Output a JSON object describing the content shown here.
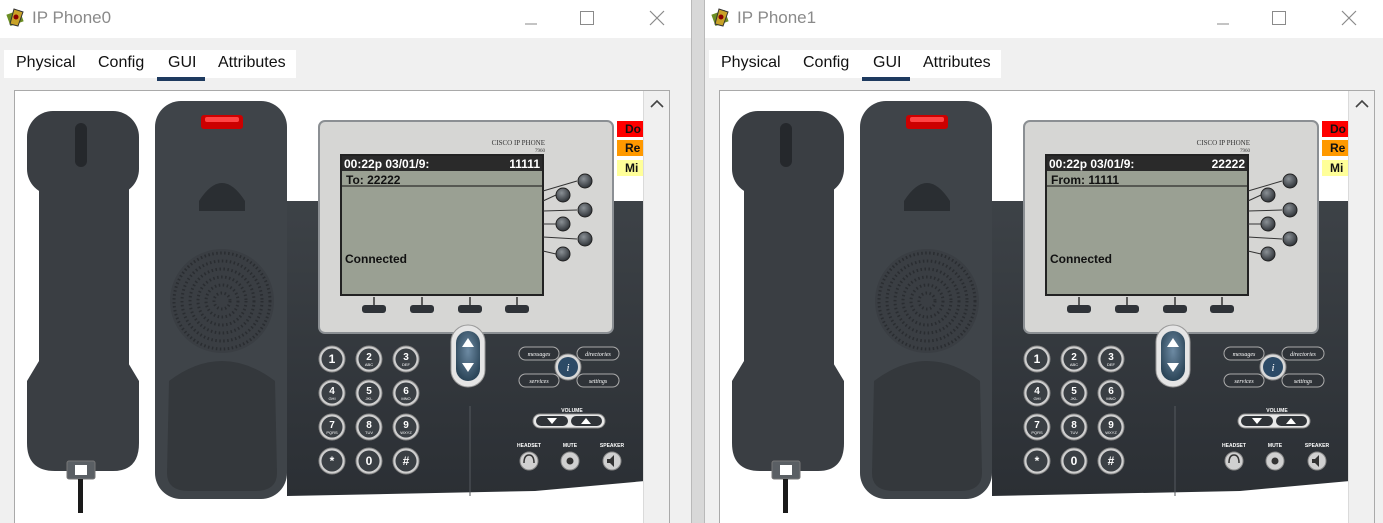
{
  "windows": [
    {
      "title": "IP Phone0",
      "tabs": [
        "Physical",
        "Config",
        "GUI",
        "Attributes"
      ],
      "active_tab": "GUI",
      "phone": {
        "brand": "CISCO IP PHONE",
        "model": "7960",
        "time": "00:22p 03/01/9:",
        "extension": "11111",
        "call_line": "To: 22222",
        "status": "Connected"
      },
      "indicators": [
        "Do",
        "Re",
        "Mi"
      ]
    },
    {
      "title": "IP Phone1",
      "tabs": [
        "Physical",
        "Config",
        "GUI",
        "Attributes"
      ],
      "active_tab": "GUI",
      "phone": {
        "brand": "CISCO IP PHONE",
        "model": "7960",
        "time": "00:22p 03/01/9:",
        "extension": "22222",
        "call_line": "From: 11111",
        "status": "Connected"
      },
      "indicators": [
        "Do",
        "Re",
        "Mi"
      ]
    }
  ],
  "keypad": [
    {
      "d": "1",
      "s": ""
    },
    {
      "d": "2",
      "s": "ABC"
    },
    {
      "d": "3",
      "s": "DEF"
    },
    {
      "d": "4",
      "s": "GHI"
    },
    {
      "d": "5",
      "s": "JKL"
    },
    {
      "d": "6",
      "s": "MNO"
    },
    {
      "d": "7",
      "s": "PQRS"
    },
    {
      "d": "8",
      "s": "TUV"
    },
    {
      "d": "9",
      "s": "WXYZ"
    },
    {
      "d": "*",
      "s": ""
    },
    {
      "d": "0",
      "s": ""
    },
    {
      "d": "#",
      "s": ""
    }
  ],
  "labels": {
    "messages": "messages",
    "directories": "directories",
    "services": "services",
    "settings": "settings",
    "volume": "VOLUME",
    "headset": "HEADSET",
    "mute": "MUTE",
    "speaker": "SPEAKER",
    "info": "i"
  },
  "colors": {
    "indicators": [
      "#ff0000",
      "#ff9900",
      "#ffff99"
    ],
    "tab_underline": "#1e3a5f",
    "screen": "#9aa093"
  }
}
